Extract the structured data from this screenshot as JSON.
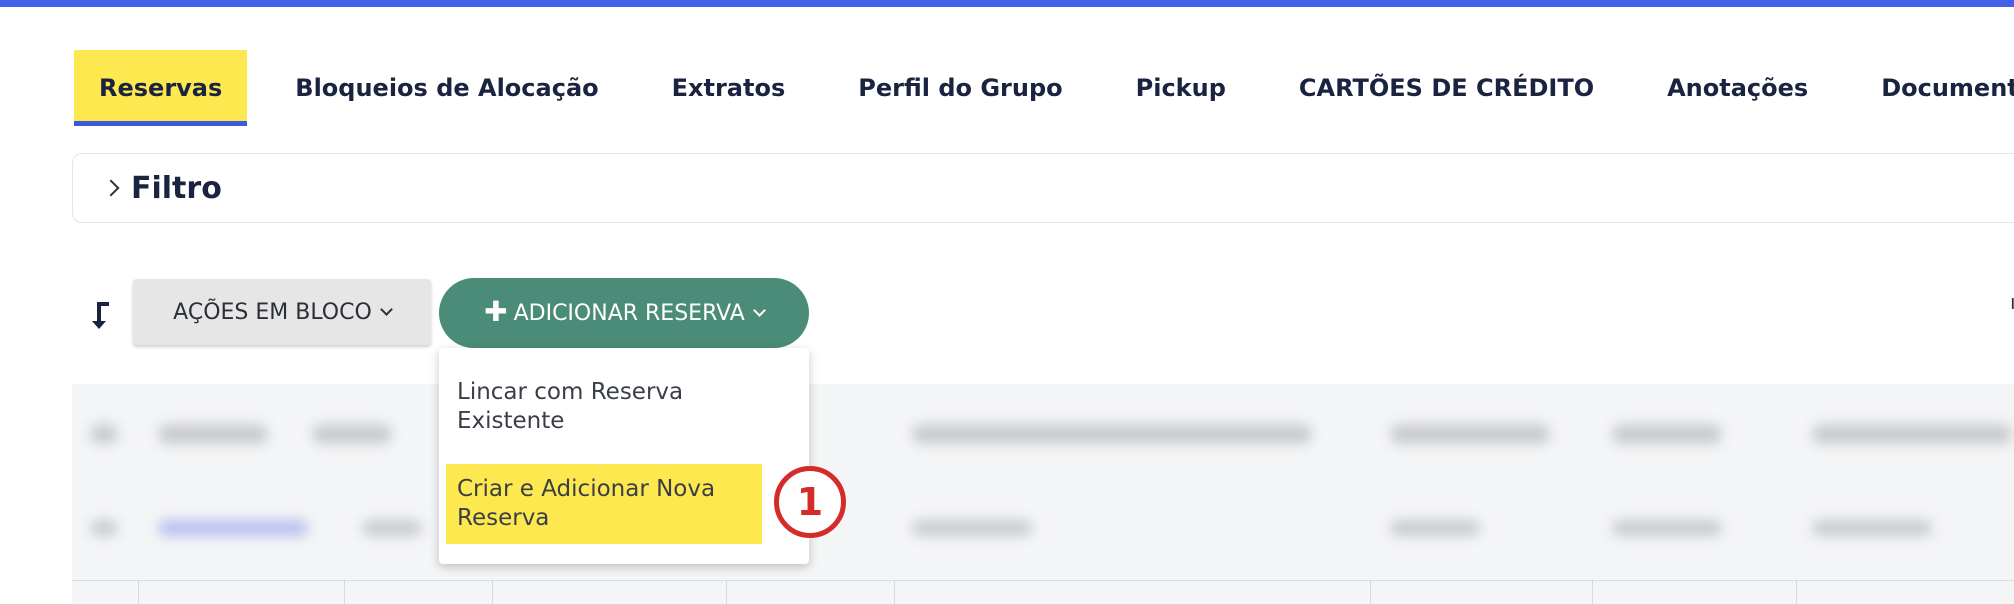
{
  "tabs": [
    {
      "label": "Reservas",
      "active": true
    },
    {
      "label": "Bloqueios de Alocação"
    },
    {
      "label": "Extratos"
    },
    {
      "label": "Perfil do Grupo"
    },
    {
      "label": "Pickup"
    },
    {
      "label": "CARTÕES DE CRÉDITO"
    },
    {
      "label": "Anotações"
    },
    {
      "label": "Documentos"
    }
  ],
  "filter": {
    "label": "Filtro"
  },
  "toolbar": {
    "bulk_actions_label": "AÇÕES EM BLOCO",
    "add_reservation_label": "ADICIONAR RESERVA",
    "add_reservation_menu": [
      {
        "label": "Lincar com Reserva Existente"
      },
      {
        "label": "Criar e Adicionar Nova Reserva",
        "highlighted": true
      }
    ]
  },
  "annotation": {
    "step_number": "1"
  },
  "colors": {
    "top_bar": "#4360e8",
    "active_tab_highlight": "#fde84f",
    "active_tab_underline": "#3b5bdb",
    "primary_button": "#4a8c78",
    "step_marker": "#d62b2b"
  }
}
